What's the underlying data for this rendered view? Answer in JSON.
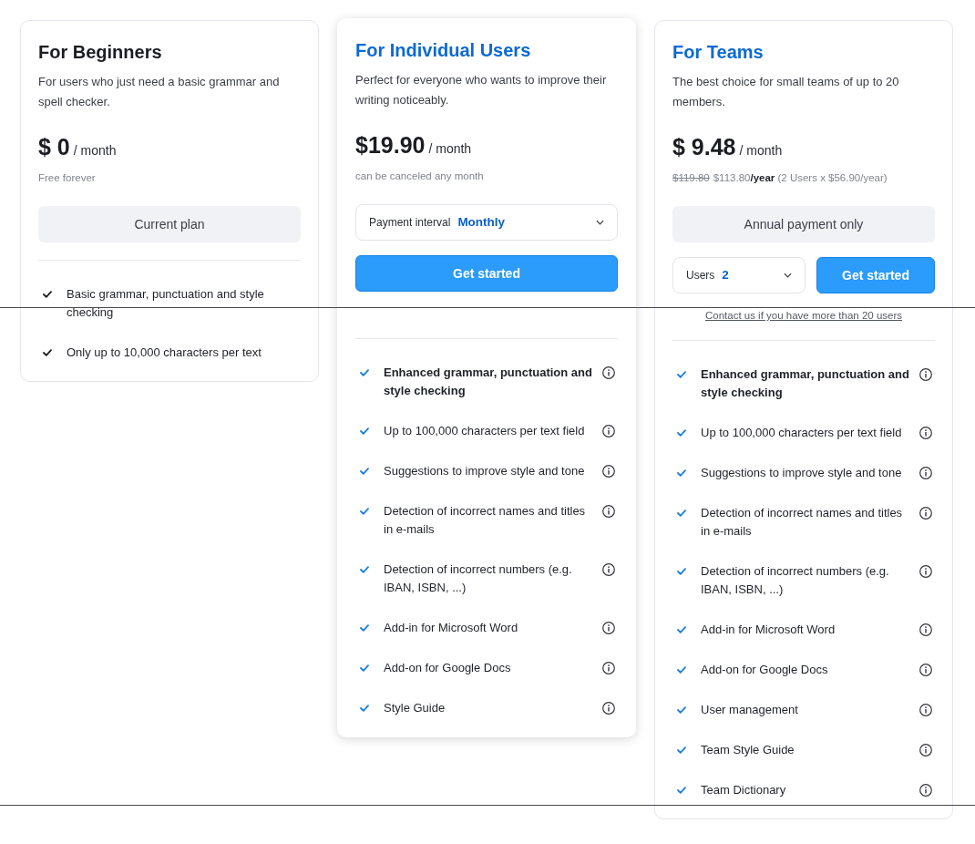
{
  "plans": [
    {
      "title": "For Beginners",
      "highlighted": false,
      "raised": false,
      "description": "For users who just need a basic grammar and spell checker.",
      "price": "$ 0",
      "period": "/ month",
      "note": "Free forever",
      "action_rows": [
        [
          {
            "kind": "status",
            "label": "Current plan"
          }
        ]
      ],
      "features": [
        {
          "text": "Basic grammar, punctuation and style checking",
          "emphasized": false,
          "info": false
        },
        {
          "text": "Only up to 10,000 characters per text",
          "emphasized": false,
          "info": false
        }
      ]
    },
    {
      "title": "For Individual Users",
      "highlighted": true,
      "raised": true,
      "description": "Perfect for everyone who wants to improve their writing noticeably.",
      "price": "$19.90",
      "period": "/ month",
      "note": "can be canceled any month",
      "action_rows": [
        [
          {
            "kind": "select",
            "label": "Payment interval",
            "value": "Monthly"
          }
        ],
        [
          {
            "kind": "button",
            "label": "Get started"
          }
        ]
      ],
      "features": [
        {
          "text": "Enhanced grammar, punctuation and style checking",
          "emphasized": true,
          "info": true
        },
        {
          "text": "Up to 100,000 characters per text field",
          "emphasized": false,
          "info": true
        },
        {
          "text": "Suggestions to improve style and tone",
          "emphasized": false,
          "info": true
        },
        {
          "text": "Detection of incorrect names and titles in e-mails",
          "emphasized": false,
          "info": true
        },
        {
          "text": "Detection of incorrect numbers (e.g. IBAN, ISBN, ...)",
          "emphasized": false,
          "info": true
        },
        {
          "text": "Add-in for Microsoft Word",
          "emphasized": false,
          "info": true
        },
        {
          "text": "Add-on for Google Docs",
          "emphasized": false,
          "info": true
        },
        {
          "text": "Style Guide",
          "emphasized": false,
          "info": true
        }
      ]
    },
    {
      "title": "For Teams",
      "highlighted": true,
      "raised": false,
      "description": "The best choice for small teams of up to 20 members.",
      "price": "$ 9.48",
      "period": "/ month",
      "old_price": "$119.80",
      "note": "$113.80**/year** (2 Users x $56.90/year)",
      "action_rows": [
        [
          {
            "kind": "status",
            "label": "Annual payment only"
          }
        ],
        [
          {
            "kind": "select",
            "label": "Users",
            "value": "2"
          },
          {
            "kind": "button",
            "label": "Get started"
          }
        ],
        [
          {
            "kind": "link",
            "label": "Contact us if you have more than 20 users"
          }
        ]
      ],
      "features": [
        {
          "text": "Enhanced grammar, punctuation and style checking",
          "emphasized": true,
          "info": true
        },
        {
          "text": "Up to 100,000 characters per text field",
          "emphasized": false,
          "info": true
        },
        {
          "text": "Suggestions to improve style and tone",
          "emphasized": false,
          "info": true
        },
        {
          "text": "Detection of incorrect names and titles in e-mails",
          "emphasized": false,
          "info": true
        },
        {
          "text": "Detection of incorrect numbers (e.g. IBAN, ISBN, ...)",
          "emphasized": false,
          "info": true
        },
        {
          "text": "Add-in for Microsoft Word",
          "emphasized": false,
          "info": true
        },
        {
          "text": "Add-on for Google Docs",
          "emphasized": false,
          "info": true
        },
        {
          "text": "User management",
          "emphasized": false,
          "info": true
        },
        {
          "text": "Team Style Guide",
          "emphasized": false,
          "info": true
        },
        {
          "text": "Team Dictionary",
          "emphasized": false,
          "info": true
        }
      ]
    }
  ]
}
